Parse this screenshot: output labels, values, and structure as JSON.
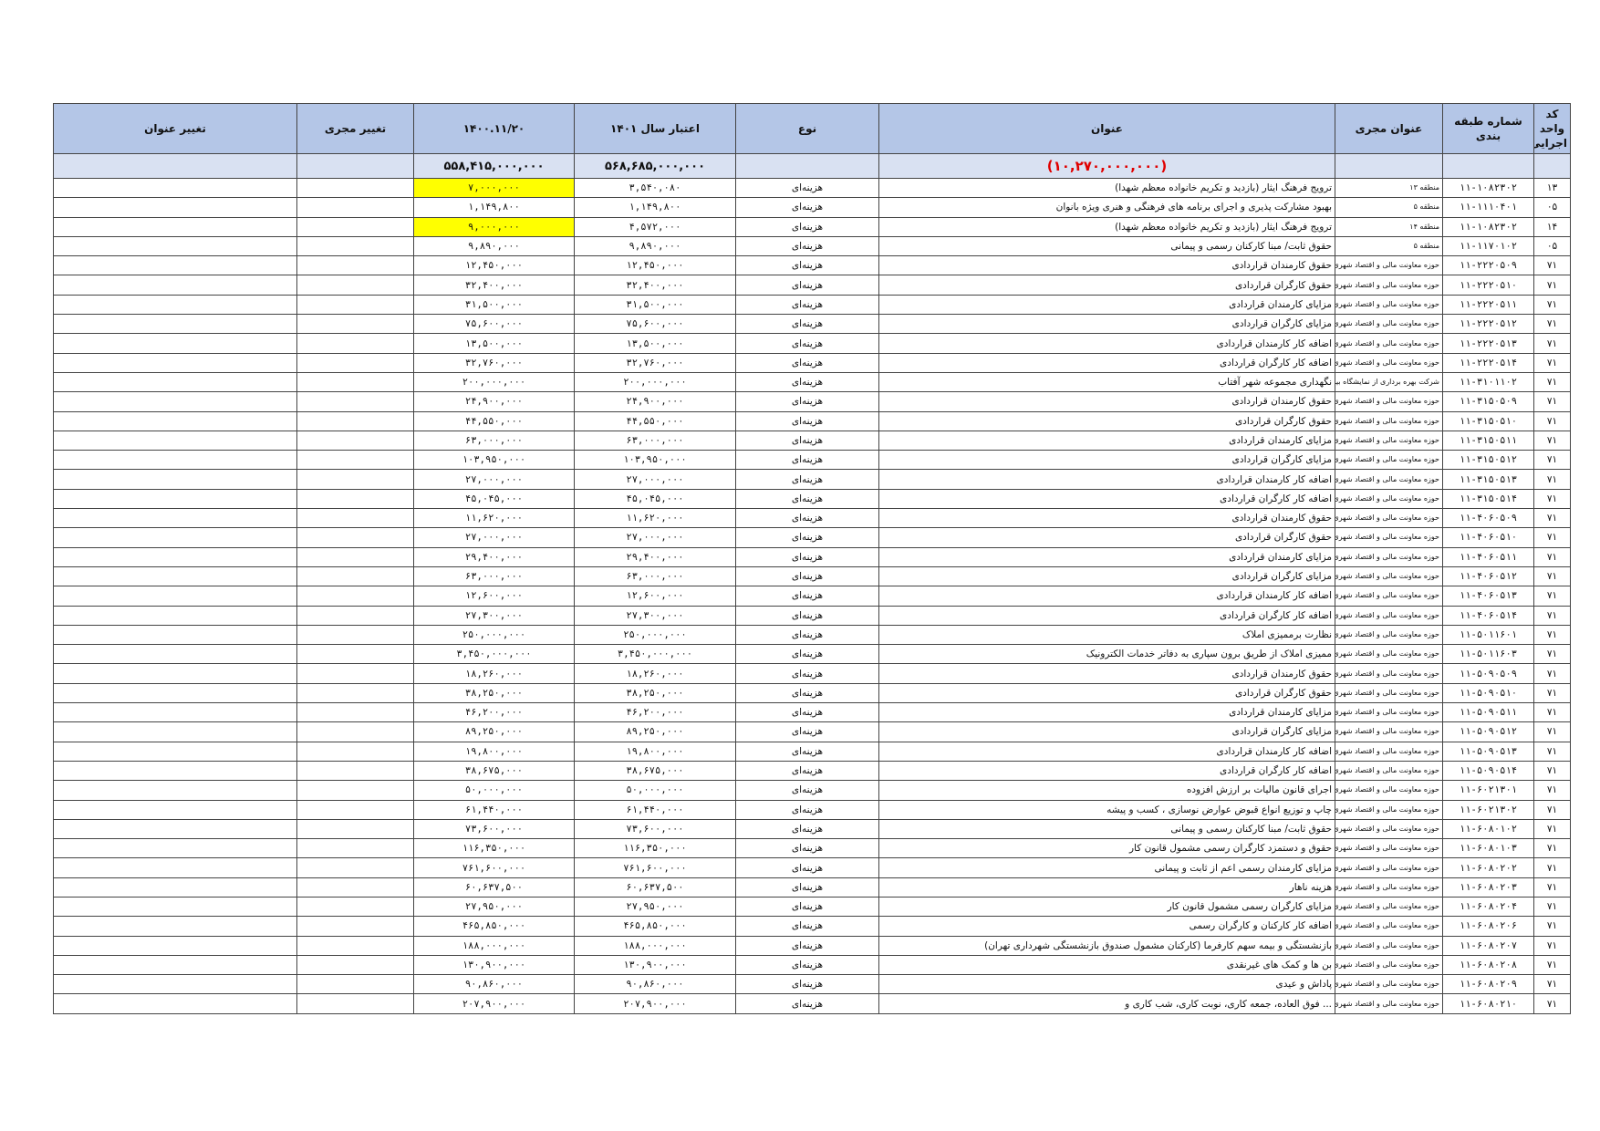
{
  "columns": [
    "کد واحد اجرایی",
    "شماره طبقه بندی",
    "عنوان مجری",
    "عنوان",
    "نوع",
    "اعتبار سال ۱۴۰۱",
    "۱۴۰۰.۱۱/۲۰",
    "تغییر مجری",
    "تغییر عنوان"
  ],
  "totals": {
    "title": "(۱۰,۲۷۰,۰۰۰,۰۰۰)",
    "budget": "۵۶۸,۶۸۵,۰۰۰,۰۰۰",
    "revised": "۵۵۸,۴۱۵,۰۰۰,۰۰۰"
  },
  "highlight_color": "#ffff00",
  "header_color": "#b4c6e7",
  "rows": [
    {
      "code": "۱۳",
      "class": "۱۱-۱۰۸۲۳۰۲",
      "exec": "منطقه ۱۳",
      "title": "ترویج فرهنگ ایثار (بازدید و تکریم خانواده معظم شهدا)",
      "type": "هزینه‌ای",
      "budget": "۳,۵۴۰,۰۸۰",
      "revised": "۷,۰۰۰,۰۰۰",
      "hl": true
    },
    {
      "code": "۰۵",
      "class": "۱۱-۱۱۱۰۴۰۱",
      "exec": "منطقه ۵",
      "title": "بهبود مشارکت پذیری و اجرای برنامه های فرهنگی و هنری ویژه بانوان",
      "type": "هزینه‌ای",
      "budget": "۱,۱۴۹,۸۰۰",
      "revised": "۱,۱۴۹,۸۰۰",
      "hl": false
    },
    {
      "code": "۱۴",
      "class": "۱۱-۱۰۸۲۳۰۲",
      "exec": "منطقه ۱۴",
      "title": "ترویج فرهنگ ایثار (بازدید و تکریم خانواده معظم شهدا)",
      "type": "هزینه‌ای",
      "budget": "۴,۵۷۲,۰۰۰",
      "revised": "۹,۰۰۰,۰۰۰",
      "hl": true
    },
    {
      "code": "۰۵",
      "class": "۱۱-۱۱۷۰۱۰۲",
      "exec": "منطقه ۵",
      "title": "حقوق ثابت/ مبنا کارکنان رسمی و پیمانی",
      "type": "هزینه‌ای",
      "budget": "۹,۸۹۰,۰۰۰",
      "revised": "۹,۸۹۰,۰۰۰",
      "hl": false
    },
    {
      "code": "۷۱",
      "class": "۱۱-۲۲۲۰۵۰۹",
      "exec": "حوزه معاونت مالی و اقتصاد شهری",
      "title": "حقوق کارمندان قراردادی",
      "type": "هزینه‌ای",
      "budget": "۱۲,۴۵۰,۰۰۰",
      "revised": "۱۲,۴۵۰,۰۰۰",
      "hl": false
    },
    {
      "code": "۷۱",
      "class": "۱۱-۲۲۲۰۵۱۰",
      "exec": "حوزه معاونت مالی و اقتصاد شهری",
      "title": "حقوق کارگران قراردادی",
      "type": "هزینه‌ای",
      "budget": "۳۲,۴۰۰,۰۰۰",
      "revised": "۳۲,۴۰۰,۰۰۰",
      "hl": false
    },
    {
      "code": "۷۱",
      "class": "۱۱-۲۲۲۰۵۱۱",
      "exec": "حوزه معاونت مالی و اقتصاد شهری",
      "title": "مزایای کارمندان قراردادی",
      "type": "هزینه‌ای",
      "budget": "۳۱,۵۰۰,۰۰۰",
      "revised": "۳۱,۵۰۰,۰۰۰",
      "hl": false
    },
    {
      "code": "۷۱",
      "class": "۱۱-۲۲۲۰۵۱۲",
      "exec": "حوزه معاونت مالی و اقتصاد شهری",
      "title": "مزایای کارگران قراردادی",
      "type": "هزینه‌ای",
      "budget": "۷۵,۶۰۰,۰۰۰",
      "revised": "۷۵,۶۰۰,۰۰۰",
      "hl": false
    },
    {
      "code": "۷۱",
      "class": "۱۱-۲۲۲۰۵۱۳",
      "exec": "حوزه معاونت مالی و اقتصاد شهری",
      "title": "اضافه کار کارمندان قراردادی",
      "type": "هزینه‌ای",
      "budget": "۱۳,۵۰۰,۰۰۰",
      "revised": "۱۳,۵۰۰,۰۰۰",
      "hl": false
    },
    {
      "code": "۷۱",
      "class": "۱۱-۲۲۲۰۵۱۴",
      "exec": "حوزه معاونت مالی و اقتصاد شهری",
      "title": "اضافه کار کارگران قراردادی",
      "type": "هزینه‌ای",
      "budget": "۳۲,۷۶۰,۰۰۰",
      "revised": "۳۲,۷۶۰,۰۰۰",
      "hl": false
    },
    {
      "code": "۷۱",
      "class": "۱۱-۳۱۰۱۱۰۲",
      "exec": "شرکت بهره برداری از نمایشگاه بین المللی شهر آفتاب",
      "title": "نگهداری مجموعه شهر آفتاب",
      "type": "هزینه‌ای",
      "budget": "۲۰۰,۰۰۰,۰۰۰",
      "revised": "۲۰۰,۰۰۰,۰۰۰",
      "hl": false
    },
    {
      "code": "۷۱",
      "class": "۱۱-۳۱۵۰۵۰۹",
      "exec": "حوزه معاونت مالی و اقتصاد شهری",
      "title": "حقوق کارمندان قراردادی",
      "type": "هزینه‌ای",
      "budget": "۲۴,۹۰۰,۰۰۰",
      "revised": "۲۴,۹۰۰,۰۰۰",
      "hl": false
    },
    {
      "code": "۷۱",
      "class": "۱۱-۳۱۵۰۵۱۰",
      "exec": "حوزه معاونت مالی و اقتصاد شهری",
      "title": "حقوق کارگران قراردادی",
      "type": "هزینه‌ای",
      "budget": "۴۴,۵۵۰,۰۰۰",
      "revised": "۴۴,۵۵۰,۰۰۰",
      "hl": false
    },
    {
      "code": "۷۱",
      "class": "۱۱-۳۱۵۰۵۱۱",
      "exec": "حوزه معاونت مالی و اقتصاد شهری",
      "title": "مزایای کارمندان قراردادی",
      "type": "هزینه‌ای",
      "budget": "۶۳,۰۰۰,۰۰۰",
      "revised": "۶۳,۰۰۰,۰۰۰",
      "hl": false
    },
    {
      "code": "۷۱",
      "class": "۱۱-۳۱۵۰۵۱۲",
      "exec": "حوزه معاونت مالی و اقتصاد شهری",
      "title": "مزایای کارگران قراردادی",
      "type": "هزینه‌ای",
      "budget": "۱۰۳,۹۵۰,۰۰۰",
      "revised": "۱۰۳,۹۵۰,۰۰۰",
      "hl": false
    },
    {
      "code": "۷۱",
      "class": "۱۱-۳۱۵۰۵۱۳",
      "exec": "حوزه معاونت مالی و اقتصاد شهری",
      "title": "اضافه کار کارمندان قراردادی",
      "type": "هزینه‌ای",
      "budget": "۲۷,۰۰۰,۰۰۰",
      "revised": "۲۷,۰۰۰,۰۰۰",
      "hl": false
    },
    {
      "code": "۷۱",
      "class": "۱۱-۳۱۵۰۵۱۴",
      "exec": "حوزه معاونت مالی و اقتصاد شهری",
      "title": "اضافه کار کارگران قراردادی",
      "type": "هزینه‌ای",
      "budget": "۴۵,۰۴۵,۰۰۰",
      "revised": "۴۵,۰۴۵,۰۰۰",
      "hl": false
    },
    {
      "code": "۷۱",
      "class": "۱۱-۴۰۶۰۵۰۹",
      "exec": "حوزه معاونت مالی و اقتصاد شهری",
      "title": "حقوق کارمندان قراردادی",
      "type": "هزینه‌ای",
      "budget": "۱۱,۶۲۰,۰۰۰",
      "revised": "۱۱,۶۲۰,۰۰۰",
      "hl": false
    },
    {
      "code": "۷۱",
      "class": "۱۱-۴۰۶۰۵۱۰",
      "exec": "حوزه معاونت مالی و اقتصاد شهری",
      "title": "حقوق کارگران قراردادی",
      "type": "هزینه‌ای",
      "budget": "۲۷,۰۰۰,۰۰۰",
      "revised": "۲۷,۰۰۰,۰۰۰",
      "hl": false
    },
    {
      "code": "۷۱",
      "class": "۱۱-۴۰۶۰۵۱۱",
      "exec": "حوزه معاونت مالی و اقتصاد شهری",
      "title": "مزایای کارمندان قراردادی",
      "type": "هزینه‌ای",
      "budget": "۲۹,۴۰۰,۰۰۰",
      "revised": "۲۹,۴۰۰,۰۰۰",
      "hl": false
    },
    {
      "code": "۷۱",
      "class": "۱۱-۴۰۶۰۵۱۲",
      "exec": "حوزه معاونت مالی و اقتصاد شهری",
      "title": "مزایای کارگران قراردادی",
      "type": "هزینه‌ای",
      "budget": "۶۳,۰۰۰,۰۰۰",
      "revised": "۶۳,۰۰۰,۰۰۰",
      "hl": false
    },
    {
      "code": "۷۱",
      "class": "۱۱-۴۰۶۰۵۱۳",
      "exec": "حوزه معاونت مالی و اقتصاد شهری",
      "title": "اضافه کار کارمندان قراردادی",
      "type": "هزینه‌ای",
      "budget": "۱۲,۶۰۰,۰۰۰",
      "revised": "۱۲,۶۰۰,۰۰۰",
      "hl": false
    },
    {
      "code": "۷۱",
      "class": "۱۱-۴۰۶۰۵۱۴",
      "exec": "حوزه معاونت مالی و اقتصاد شهری",
      "title": "اضافه کار کارگران قراردادی",
      "type": "هزینه‌ای",
      "budget": "۲۷,۳۰۰,۰۰۰",
      "revised": "۲۷,۳۰۰,۰۰۰",
      "hl": false
    },
    {
      "code": "۷۱",
      "class": "۱۱-۵۰۱۱۶۰۱",
      "exec": "حوزه معاونت مالی و اقتصاد شهری",
      "title": "نظارت برممیزی املاک",
      "type": "هزینه‌ای",
      "budget": "۲۵۰,۰۰۰,۰۰۰",
      "revised": "۲۵۰,۰۰۰,۰۰۰",
      "hl": false
    },
    {
      "code": "۷۱",
      "class": "۱۱-۵۰۱۱۶۰۳",
      "exec": "حوزه معاونت مالی و اقتصاد شهری",
      "title": "ممیزی املاک از طریق برون سپاری به دفاتر خدمات الکترونیک",
      "type": "هزینه‌ای",
      "budget": "۳,۴۵۰,۰۰۰,۰۰۰",
      "revised": "۳,۴۵۰,۰۰۰,۰۰۰",
      "hl": false
    },
    {
      "code": "۷۱",
      "class": "۱۱-۵۰۹۰۵۰۹",
      "exec": "حوزه معاونت مالی و اقتصاد شهری",
      "title": "حقوق کارمندان قراردادی",
      "type": "هزینه‌ای",
      "budget": "۱۸,۲۶۰,۰۰۰",
      "revised": "۱۸,۲۶۰,۰۰۰",
      "hl": false
    },
    {
      "code": "۷۱",
      "class": "۱۱-۵۰۹۰۵۱۰",
      "exec": "حوزه معاونت مالی و اقتصاد شهری",
      "title": "حقوق کارگران قراردادی",
      "type": "هزینه‌ای",
      "budget": "۳۸,۲۵۰,۰۰۰",
      "revised": "۳۸,۲۵۰,۰۰۰",
      "hl": false
    },
    {
      "code": "۷۱",
      "class": "۱۱-۵۰۹۰۵۱۱",
      "exec": "حوزه معاونت مالی و اقتصاد شهری",
      "title": "مزایای کارمندان قراردادی",
      "type": "هزینه‌ای",
      "budget": "۴۶,۲۰۰,۰۰۰",
      "revised": "۴۶,۲۰۰,۰۰۰",
      "hl": false
    },
    {
      "code": "۷۱",
      "class": "۱۱-۵۰۹۰۵۱۲",
      "exec": "حوزه معاونت مالی و اقتصاد شهری",
      "title": "مزایای کارگران قراردادی",
      "type": "هزینه‌ای",
      "budget": "۸۹,۲۵۰,۰۰۰",
      "revised": "۸۹,۲۵۰,۰۰۰",
      "hl": false
    },
    {
      "code": "۷۱",
      "class": "۱۱-۵۰۹۰۵۱۳",
      "exec": "حوزه معاونت مالی و اقتصاد شهری",
      "title": "اضافه کار کارمندان قراردادی",
      "type": "هزینه‌ای",
      "budget": "۱۹,۸۰۰,۰۰۰",
      "revised": "۱۹,۸۰۰,۰۰۰",
      "hl": false
    },
    {
      "code": "۷۱",
      "class": "۱۱-۵۰۹۰۵۱۴",
      "exec": "حوزه معاونت مالی و اقتصاد شهری",
      "title": "اضافه کار کارگران قراردادی",
      "type": "هزینه‌ای",
      "budget": "۳۸,۶۷۵,۰۰۰",
      "revised": "۳۸,۶۷۵,۰۰۰",
      "hl": false
    },
    {
      "code": "۷۱",
      "class": "۱۱-۶۰۲۱۳۰۱",
      "exec": "حوزه معاونت مالی و اقتصاد شهری",
      "title": "اجرای قانون مالیات بر ارزش افزوده",
      "type": "هزینه‌ای",
      "budget": "۵۰,۰۰۰,۰۰۰",
      "revised": "۵۰,۰۰۰,۰۰۰",
      "hl": false
    },
    {
      "code": "۷۱",
      "class": "۱۱-۶۰۲۱۳۰۲",
      "exec": "حوزه معاونت مالی و اقتصاد شهری",
      "title": "چاپ و توزیع انواع قبوض عوارض نوسازی ، کسب و پیشه",
      "type": "هزینه‌ای",
      "budget": "۶۱,۴۴۰,۰۰۰",
      "revised": "۶۱,۴۴۰,۰۰۰",
      "hl": false
    },
    {
      "code": "۷۱",
      "class": "۱۱-۶۰۸۰۱۰۲",
      "exec": "حوزه معاونت مالی و اقتصاد شهری",
      "title": "حقوق ثابت/ مبنا کارکنان رسمی و پیمانی",
      "type": "هزینه‌ای",
      "budget": "۷۳,۶۰۰,۰۰۰",
      "revised": "۷۳,۶۰۰,۰۰۰",
      "hl": false
    },
    {
      "code": "۷۱",
      "class": "۱۱-۶۰۸۰۱۰۳",
      "exec": "حوزه معاونت مالی و اقتصاد شهری",
      "title": "حقوق و دستمزد کارگران رسمی مشمول قانون کار",
      "type": "هزینه‌ای",
      "budget": "۱۱۶,۳۵۰,۰۰۰",
      "revised": "۱۱۶,۳۵۰,۰۰۰",
      "hl": false
    },
    {
      "code": "۷۱",
      "class": "۱۱-۶۰۸۰۲۰۲",
      "exec": "حوزه معاونت مالی و اقتصاد شهری",
      "title": "مزایای کارمندان رسمی اعم از ثابت و پیمانی",
      "type": "هزینه‌ای",
      "budget": "۷۶۱,۶۰۰,۰۰۰",
      "revised": "۷۶۱,۶۰۰,۰۰۰",
      "hl": false
    },
    {
      "code": "۷۱",
      "class": "۱۱-۶۰۸۰۲۰۳",
      "exec": "حوزه معاونت مالی و اقتصاد شهری",
      "title": "هزینه ناهار",
      "type": "هزینه‌ای",
      "budget": "۶۰,۶۳۷,۵۰۰",
      "revised": "۶۰,۶۳۷,۵۰۰",
      "hl": false
    },
    {
      "code": "۷۱",
      "class": "۱۱-۶۰۸۰۲۰۴",
      "exec": "حوزه معاونت مالی و اقتصاد شهری",
      "title": "مزایای کارگران رسمی مشمول قانون کار",
      "type": "هزینه‌ای",
      "budget": "۲۷,۹۵۰,۰۰۰",
      "revised": "۲۷,۹۵۰,۰۰۰",
      "hl": false
    },
    {
      "code": "۷۱",
      "class": "۱۱-۶۰۸۰۲۰۶",
      "exec": "حوزه معاونت مالی و اقتصاد شهری",
      "title": "اضافه کار کارکنان و کارگران رسمی",
      "type": "هزینه‌ای",
      "budget": "۴۶۵,۸۵۰,۰۰۰",
      "revised": "۴۶۵,۸۵۰,۰۰۰",
      "hl": false
    },
    {
      "code": "۷۱",
      "class": "۱۱-۶۰۸۰۲۰۷",
      "exec": "حوزه معاونت مالی و اقتصاد شهری",
      "title": "بازنشستگی و بیمه سهم کارفرما (کارکنان مشمول صندوق بازنشستگی شهرداری تهران)",
      "type": "هزینه‌ای",
      "budget": "۱۸۸,۰۰۰,۰۰۰",
      "revised": "۱۸۸,۰۰۰,۰۰۰",
      "hl": false
    },
    {
      "code": "۷۱",
      "class": "۱۱-۶۰۸۰۲۰۸",
      "exec": "حوزه معاونت مالی و اقتصاد شهری",
      "title": "بن ها و کمک های غیرنقدی",
      "type": "هزینه‌ای",
      "budget": "۱۳۰,۹۰۰,۰۰۰",
      "revised": "۱۳۰,۹۰۰,۰۰۰",
      "hl": false
    },
    {
      "code": "۷۱",
      "class": "۱۱-۶۰۸۰۲۰۹",
      "exec": "حوزه معاونت مالی و اقتصاد شهری",
      "title": "پاداش و عیدی",
      "type": "هزینه‌ای",
      "budget": "۹۰,۸۶۰,۰۰۰",
      "revised": "۹۰,۸۶۰,۰۰۰",
      "hl": false
    },
    {
      "code": "۷۱",
      "class": "۱۱-۶۰۸۰۲۱۰",
      "exec": "حوزه معاونت مالی و اقتصاد شهری",
      "title": "... فوق العاده، جمعه کاری، نوبت کاری، شب کاری و",
      "type": "هزینه‌ای",
      "budget": "۲۰۷,۹۰۰,۰۰۰",
      "revised": "۲۰۷,۹۰۰,۰۰۰",
      "hl": false
    }
  ]
}
